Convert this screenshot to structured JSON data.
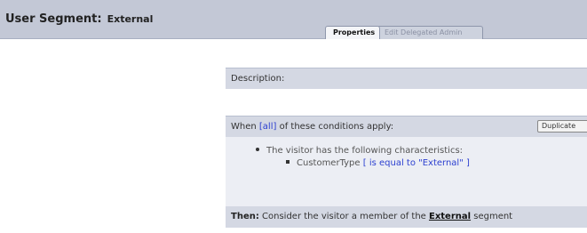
{
  "header": {
    "title_label": "User Segment:",
    "segment_name": "External"
  },
  "tabs": [
    {
      "label": "Properties",
      "active": true
    },
    {
      "label": "Edit Delegated Admin",
      "active": false
    }
  ],
  "description": {
    "label": "Description:"
  },
  "conditions": {
    "prefix": "When ",
    "quantifier": "[all]",
    "suffix": " of these conditions apply:",
    "duplicate_label": "Duplicate",
    "rule_intro": "The visitor has the following characteristics:",
    "attribute": "CustomerType",
    "criterion": "[ is equal to \"External\" ]"
  },
  "then": {
    "label": "Then:",
    "text_before": " Consider the visitor a member of the ",
    "segment_link": "External",
    "text_after": " segment"
  },
  "colors": {
    "header_bg": "#c3c8d6",
    "panel_bg": "#d4d8e3",
    "body_bg": "#eceef4",
    "link": "#2b3fd0"
  }
}
